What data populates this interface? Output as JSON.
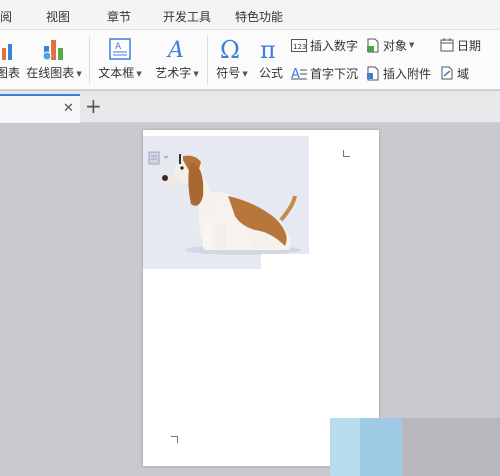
{
  "menu": {
    "tabs": [
      "阅",
      "视图",
      "章节",
      "开发工具",
      "特色功能"
    ]
  },
  "ribbon": {
    "chart_partial": "图表",
    "online_chart": "在线图表",
    "textbox": "文本框",
    "wordart": "艺术字",
    "symbol": "符号",
    "formula": "公式",
    "insert_number": "插入数字",
    "dropcap": "首字下沉",
    "object": "对象",
    "attach_file": "插入附件",
    "date": "日期",
    "field": "域",
    "number_icon_text": "123"
  },
  "colors": {
    "accent": "#3c7fd8",
    "icon_blue": "#2f7bd6",
    "page_bg": "#ffffff",
    "workspace_bg": "#c9cacf"
  }
}
